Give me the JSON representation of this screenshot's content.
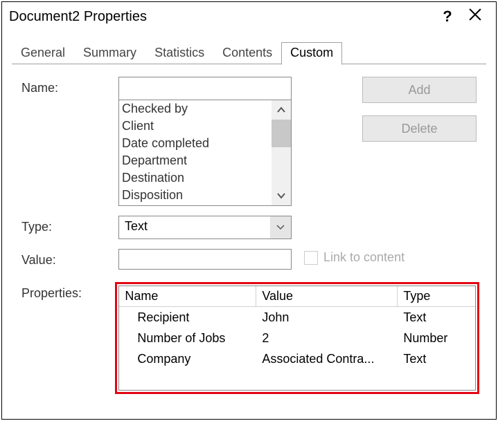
{
  "title": "Document2 Properties",
  "tabs": {
    "general": "General",
    "summary": "Summary",
    "statistics": "Statistics",
    "contents": "Contents",
    "custom": "Custom"
  },
  "labels": {
    "name": "Name:",
    "type": "Type:",
    "value": "Value:",
    "properties": "Properties:",
    "link_to_content": "Link to content"
  },
  "buttons": {
    "add": "Add",
    "delete": "Delete"
  },
  "name_list": {
    "items": [
      "Checked by",
      "Client",
      "Date completed",
      "Department",
      "Destination",
      "Disposition"
    ]
  },
  "type_select": {
    "value": "Text"
  },
  "table": {
    "headers": {
      "name": "Name",
      "value": "Value",
      "type": "Type"
    },
    "rows": [
      {
        "name": "Recipient",
        "value": "John",
        "type": "Text"
      },
      {
        "name": "Number of Jobs",
        "value": "2",
        "type": "Number"
      },
      {
        "name": "Company",
        "value": "Associated Contra...",
        "type": "Text"
      }
    ]
  }
}
